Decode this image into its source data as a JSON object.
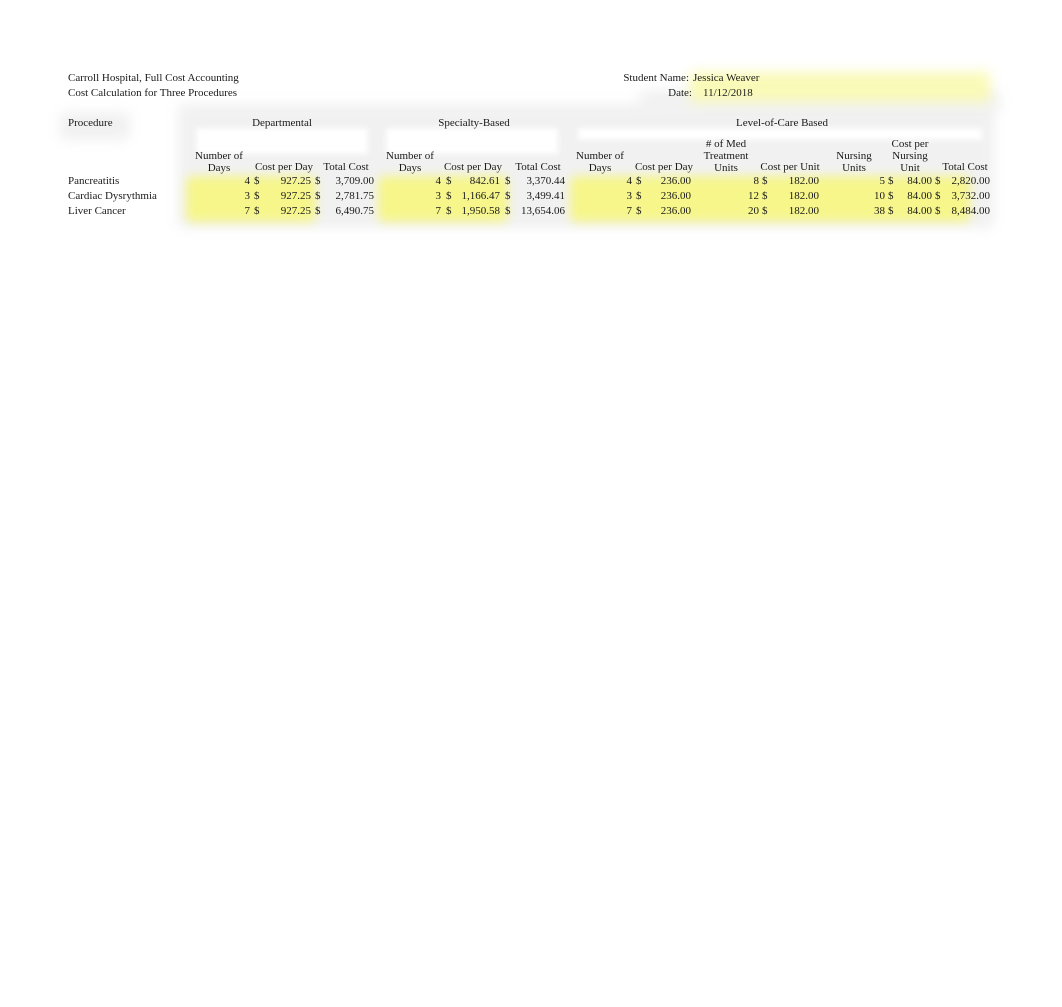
{
  "header": {
    "title": "Carroll Hospital, Full Cost Accounting",
    "subtitle": "Cost Calculation for Three Procedures",
    "student_name_label": "Student Name:",
    "student_name_value": "Jessica Weaver",
    "date_label": "Date:",
    "date_value": "11/12/2018"
  },
  "table": {
    "procedure_header": "Procedure",
    "groups": {
      "departmental": "Departmental",
      "specialty": "Specialty-Based",
      "level_of_care": "Level-of-Care Based"
    },
    "columns": {
      "dept_days": [
        "Number of",
        "Days"
      ],
      "dept_cost_per_day": "Cost per Day",
      "dept_total": "Total Cost",
      "spec_days": [
        "Number of",
        "Days"
      ],
      "spec_cost_per_day": "Cost per Day",
      "spec_total": "Total Cost",
      "loc_days": [
        "Number of",
        "Days"
      ],
      "loc_cost_per_day": "Cost per Day",
      "loc_med_units": [
        "# of Med",
        "Treatment",
        "Units"
      ],
      "loc_cost_per_unit": "Cost per Unit",
      "loc_nursing_units": [
        "Nursing",
        "Units"
      ],
      "loc_cost_per_nursing": [
        "Cost per",
        "Nursing",
        "Unit"
      ],
      "loc_total": "Total Cost"
    },
    "currency_symbol": "$",
    "rows": [
      {
        "procedure": "Pancreatitis",
        "dept_days": "4",
        "dept_cost_per_day": "927.25",
        "dept_total": "3,709.00",
        "spec_days": "4",
        "spec_cost_per_day": "842.61",
        "spec_total": "3,370.44",
        "loc_days": "4",
        "loc_cost_per_day": "236.00",
        "loc_med_units": "8",
        "loc_cost_per_unit": "182.00",
        "loc_nursing_units": "5",
        "loc_cost_per_nursing": "84.00",
        "loc_total": "2,820.00"
      },
      {
        "procedure": "Cardiac Dysrythmia",
        "dept_days": "3",
        "dept_cost_per_day": "927.25",
        "dept_total": "2,781.75",
        "spec_days": "3",
        "spec_cost_per_day": "1,166.47",
        "spec_total": "3,499.41",
        "loc_days": "3",
        "loc_cost_per_day": "236.00",
        "loc_med_units": "12",
        "loc_cost_per_unit": "182.00",
        "loc_nursing_units": "10",
        "loc_cost_per_nursing": "84.00",
        "loc_total": "3,732.00"
      },
      {
        "procedure": "Liver Cancer",
        "dept_days": "7",
        "dept_cost_per_day": "927.25",
        "dept_total": "6,490.75",
        "spec_days": "7",
        "spec_cost_per_day": "1,950.58",
        "spec_total": "13,654.06",
        "loc_days": "7",
        "loc_cost_per_day": "236.00",
        "loc_med_units": "20",
        "loc_cost_per_unit": "182.00",
        "loc_nursing_units": "38",
        "loc_cost_per_nursing": "84.00",
        "loc_total": "8,484.00"
      }
    ]
  },
  "colors": {
    "highlight": "#f7f77a",
    "shade": "#f1f1f1",
    "text": "#1a1a1a"
  }
}
